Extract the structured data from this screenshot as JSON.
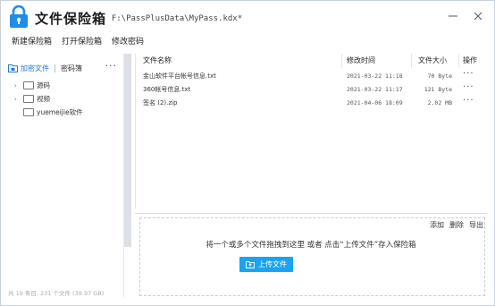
{
  "app": {
    "title": "文件保险箱",
    "file_path": "- F:\\PassPlusData\\MyPass.kdx*"
  },
  "menu": [
    "新建保险箱",
    "打开保险箱",
    "修改密码"
  ],
  "sidebar": {
    "tabs": {
      "active": "加密文件",
      "other": "密码簿"
    },
    "more": "···",
    "tree": [
      {
        "label": "源码",
        "expandable": true
      },
      {
        "label": "视频",
        "expandable": true
      },
      {
        "label": "yuemeijie软件",
        "expandable": false
      }
    ],
    "footer": "共 19 条目, 231 个文件 (39.97 GB)"
  },
  "file_table": {
    "headers": {
      "name": "文件名称",
      "time": "修改时间",
      "size": "文件大小",
      "action": "操作"
    },
    "rows": [
      {
        "name": "金山软件平台帐号信息.txt",
        "time": "2021-03-22 11:18",
        "size": "70 Byte",
        "more": "···"
      },
      {
        "name": "360帐号信息.txt",
        "time": "2021-03-22 11:17",
        "size": "121 Byte",
        "more": "···"
      },
      {
        "name": "签名 (2).zip",
        "time": "2021-04-06 18:09",
        "size": "2.02 MB",
        "more": "···"
      }
    ]
  },
  "upload": {
    "actions": [
      "添加",
      "删除",
      "导出"
    ],
    "hint": "将一个或多个文件拖拽到这里 或者 点击“上传文件”存入保险箱",
    "button": "上传文件"
  },
  "colors": {
    "accent": "#1f7ae0",
    "button": "#1aa3f0"
  }
}
